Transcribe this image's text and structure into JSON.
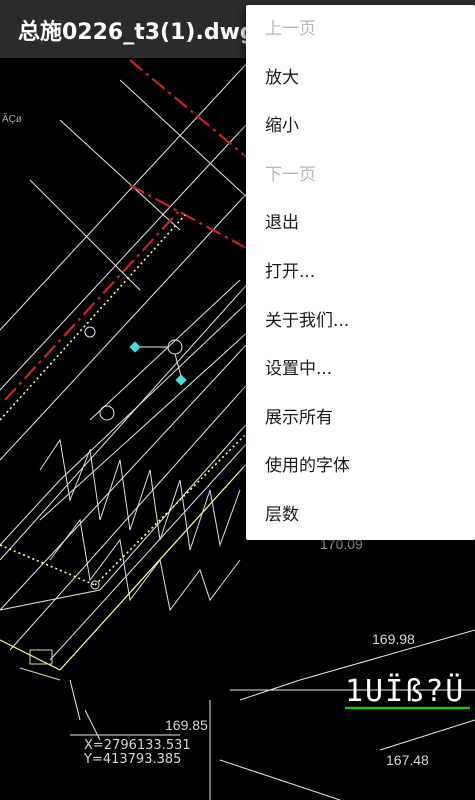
{
  "titlebar": {
    "title": "总施0226_t3(1).dwg"
  },
  "menu": {
    "items": [
      {
        "label": "上一页",
        "enabled": false
      },
      {
        "label": "放大",
        "enabled": true
      },
      {
        "label": "缩小",
        "enabled": true
      },
      {
        "label": "下一页",
        "enabled": false
      },
      {
        "label": "退出",
        "enabled": true
      },
      {
        "label": "打开...",
        "enabled": true
      },
      {
        "label": "关于我们...",
        "enabled": true
      },
      {
        "label": "设置中...",
        "enabled": true
      },
      {
        "label": "展示所有",
        "enabled": true
      },
      {
        "label": "使用的字体",
        "enabled": true
      },
      {
        "label": "层数",
        "enabled": true
      }
    ]
  },
  "drawing": {
    "coord_x": "X=2796133.531",
    "coord_y": "Y=413793.385",
    "elevations": [
      "170.09",
      "169.98",
      "169.85",
      "167.48"
    ],
    "symbol_text": "1UÏß?Ü",
    "side_label": "ĂÇø"
  },
  "colors": {
    "background": "#000000",
    "titlebar": "#2b2b2b",
    "menu_bg": "#ffffff",
    "red_line": "#d0202a",
    "yellow_dotted": "#ffff99",
    "cyan": "#40e0e0",
    "green_line": "#20c020"
  }
}
